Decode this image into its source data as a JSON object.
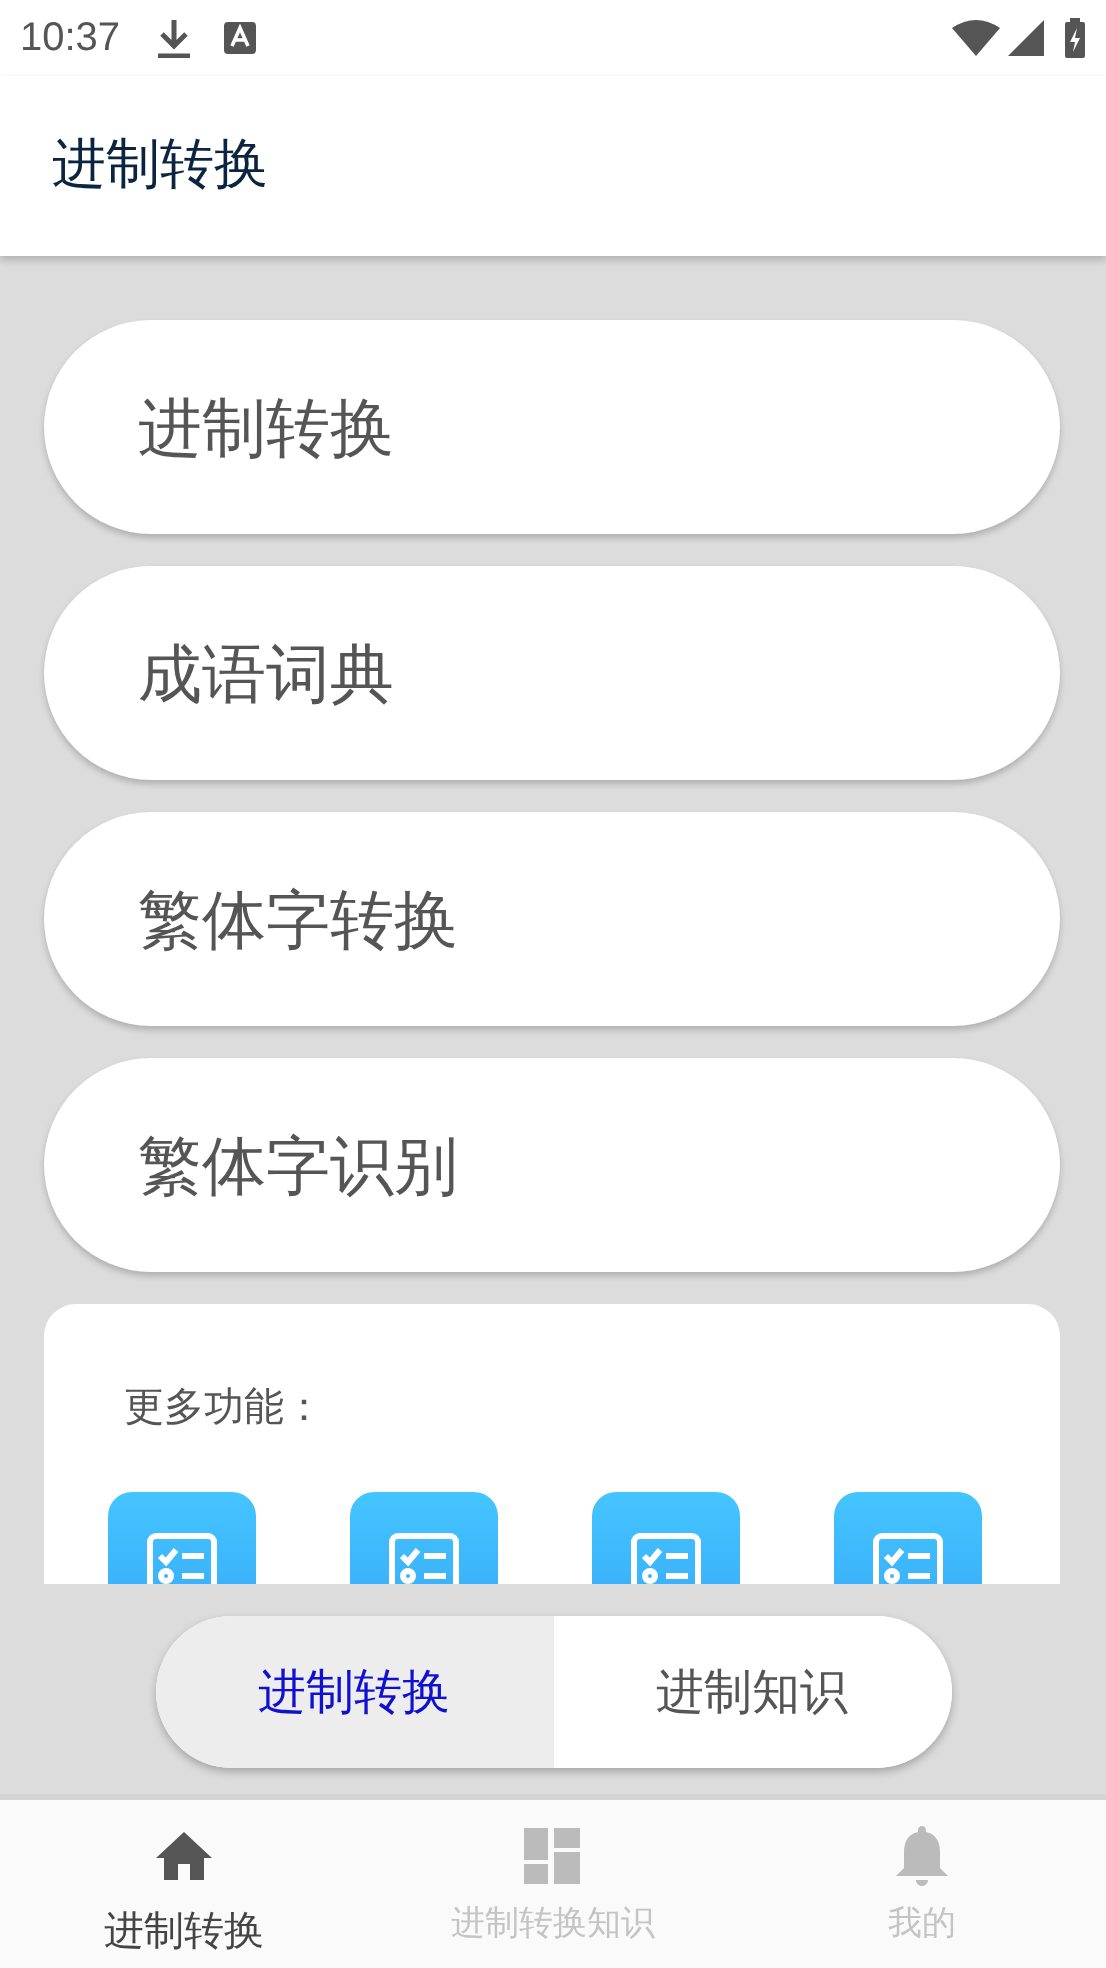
{
  "status_bar": {
    "time": "10:37"
  },
  "app_bar": {
    "title": "进制转换"
  },
  "menu_items": [
    {
      "label": "进制转换"
    },
    {
      "label": "成语词典"
    },
    {
      "label": "繁体字转换"
    },
    {
      "label": "繁体字识别"
    }
  ],
  "more_panel": {
    "title": "更多功能：",
    "tools": [
      {
        "kind": "checklist"
      },
      {
        "kind": "checklist"
      },
      {
        "kind": "checklist"
      },
      {
        "kind": "checklist"
      }
    ]
  },
  "segment_tabs": [
    {
      "label": "进制转换",
      "selected": true
    },
    {
      "label": "进制知识",
      "selected": false
    }
  ],
  "bottom_nav": [
    {
      "label": "进制转换",
      "kind": "home",
      "selected": true
    },
    {
      "label": "进制转换知识",
      "kind": "dashboard",
      "selected": false
    },
    {
      "label": "我的",
      "kind": "bell",
      "selected": false
    }
  ]
}
